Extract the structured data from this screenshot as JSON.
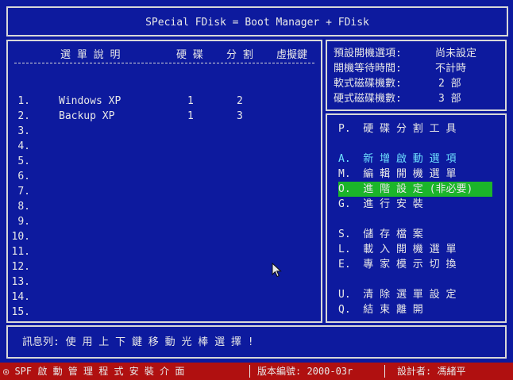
{
  "window": {
    "title": "SPecial FDisk = Boot Manager + FDisk"
  },
  "table": {
    "headers": {
      "desc": "選 單 說 明",
      "disk": "硬 碟",
      "part": "分 割",
      "key": "虛擬鍵"
    },
    "rows": [
      {
        "no": "1.",
        "name": "Windows XP",
        "disk": "1",
        "part": "2"
      },
      {
        "no": "2.",
        "name": "Backup XP",
        "disk": "1",
        "part": "3"
      },
      {
        "no": "3.",
        "name": "",
        "disk": "",
        "part": ""
      },
      {
        "no": "4.",
        "name": "",
        "disk": "",
        "part": ""
      },
      {
        "no": "5.",
        "name": "",
        "disk": "",
        "part": ""
      },
      {
        "no": "6.",
        "name": "",
        "disk": "",
        "part": ""
      },
      {
        "no": "7.",
        "name": "",
        "disk": "",
        "part": ""
      },
      {
        "no": "8.",
        "name": "",
        "disk": "",
        "part": ""
      },
      {
        "no": "9.",
        "name": "",
        "disk": "",
        "part": ""
      },
      {
        "no": "10.",
        "name": "",
        "disk": "",
        "part": ""
      },
      {
        "no": "11.",
        "name": "",
        "disk": "",
        "part": ""
      },
      {
        "no": "12.",
        "name": "",
        "disk": "",
        "part": ""
      },
      {
        "no": "13.",
        "name": "",
        "disk": "",
        "part": ""
      },
      {
        "no": "14.",
        "name": "",
        "disk": "",
        "part": ""
      },
      {
        "no": "15.",
        "name": "",
        "disk": "",
        "part": ""
      }
    ]
  },
  "info": {
    "default_label": "預設開機選項:",
    "default_value": "尚未設定",
    "wait_label": "開機等待時間:",
    "wait_value": "不計時",
    "floppy_label": "軟式磁碟機數:",
    "floppy_value": "2 部",
    "hdd_label": "硬式磁碟機數:",
    "hdd_value": "3 部"
  },
  "menu": {
    "partition_tool": "P.  硬 碟 分 割 工 具",
    "add_boot": "A.  新 增 啟 動 選 項",
    "edit_menu": "M.  編 輯 開 機 選 單",
    "advanced": "O.  進 階 設 定 (非必要)",
    "install": "G.  進 行 安 裝",
    "save": "S.  儲 存 檔 案",
    "load": "L.  載 入 開 機 選 單",
    "expert": "E.  專 家 模 示 切 換",
    "clear": "U.  清 除 選 單 設 定",
    "quit": "Q.  結 束 離 開"
  },
  "message": {
    "text": "訊息列: 使 用 上 下 鍵 移 動 光 棒 選 擇 !"
  },
  "status": {
    "app": "◎ SPF 啟 動 管 理 程 式 安 裝 介 面",
    "version": "版本編號: 2000-03r",
    "author": "設計者: 馮緒平"
  },
  "colors": {
    "background": "#0d1a9e",
    "highlight": "#1bb52a",
    "status_bar": "#b01010",
    "accent": "#6ee0ff"
  }
}
